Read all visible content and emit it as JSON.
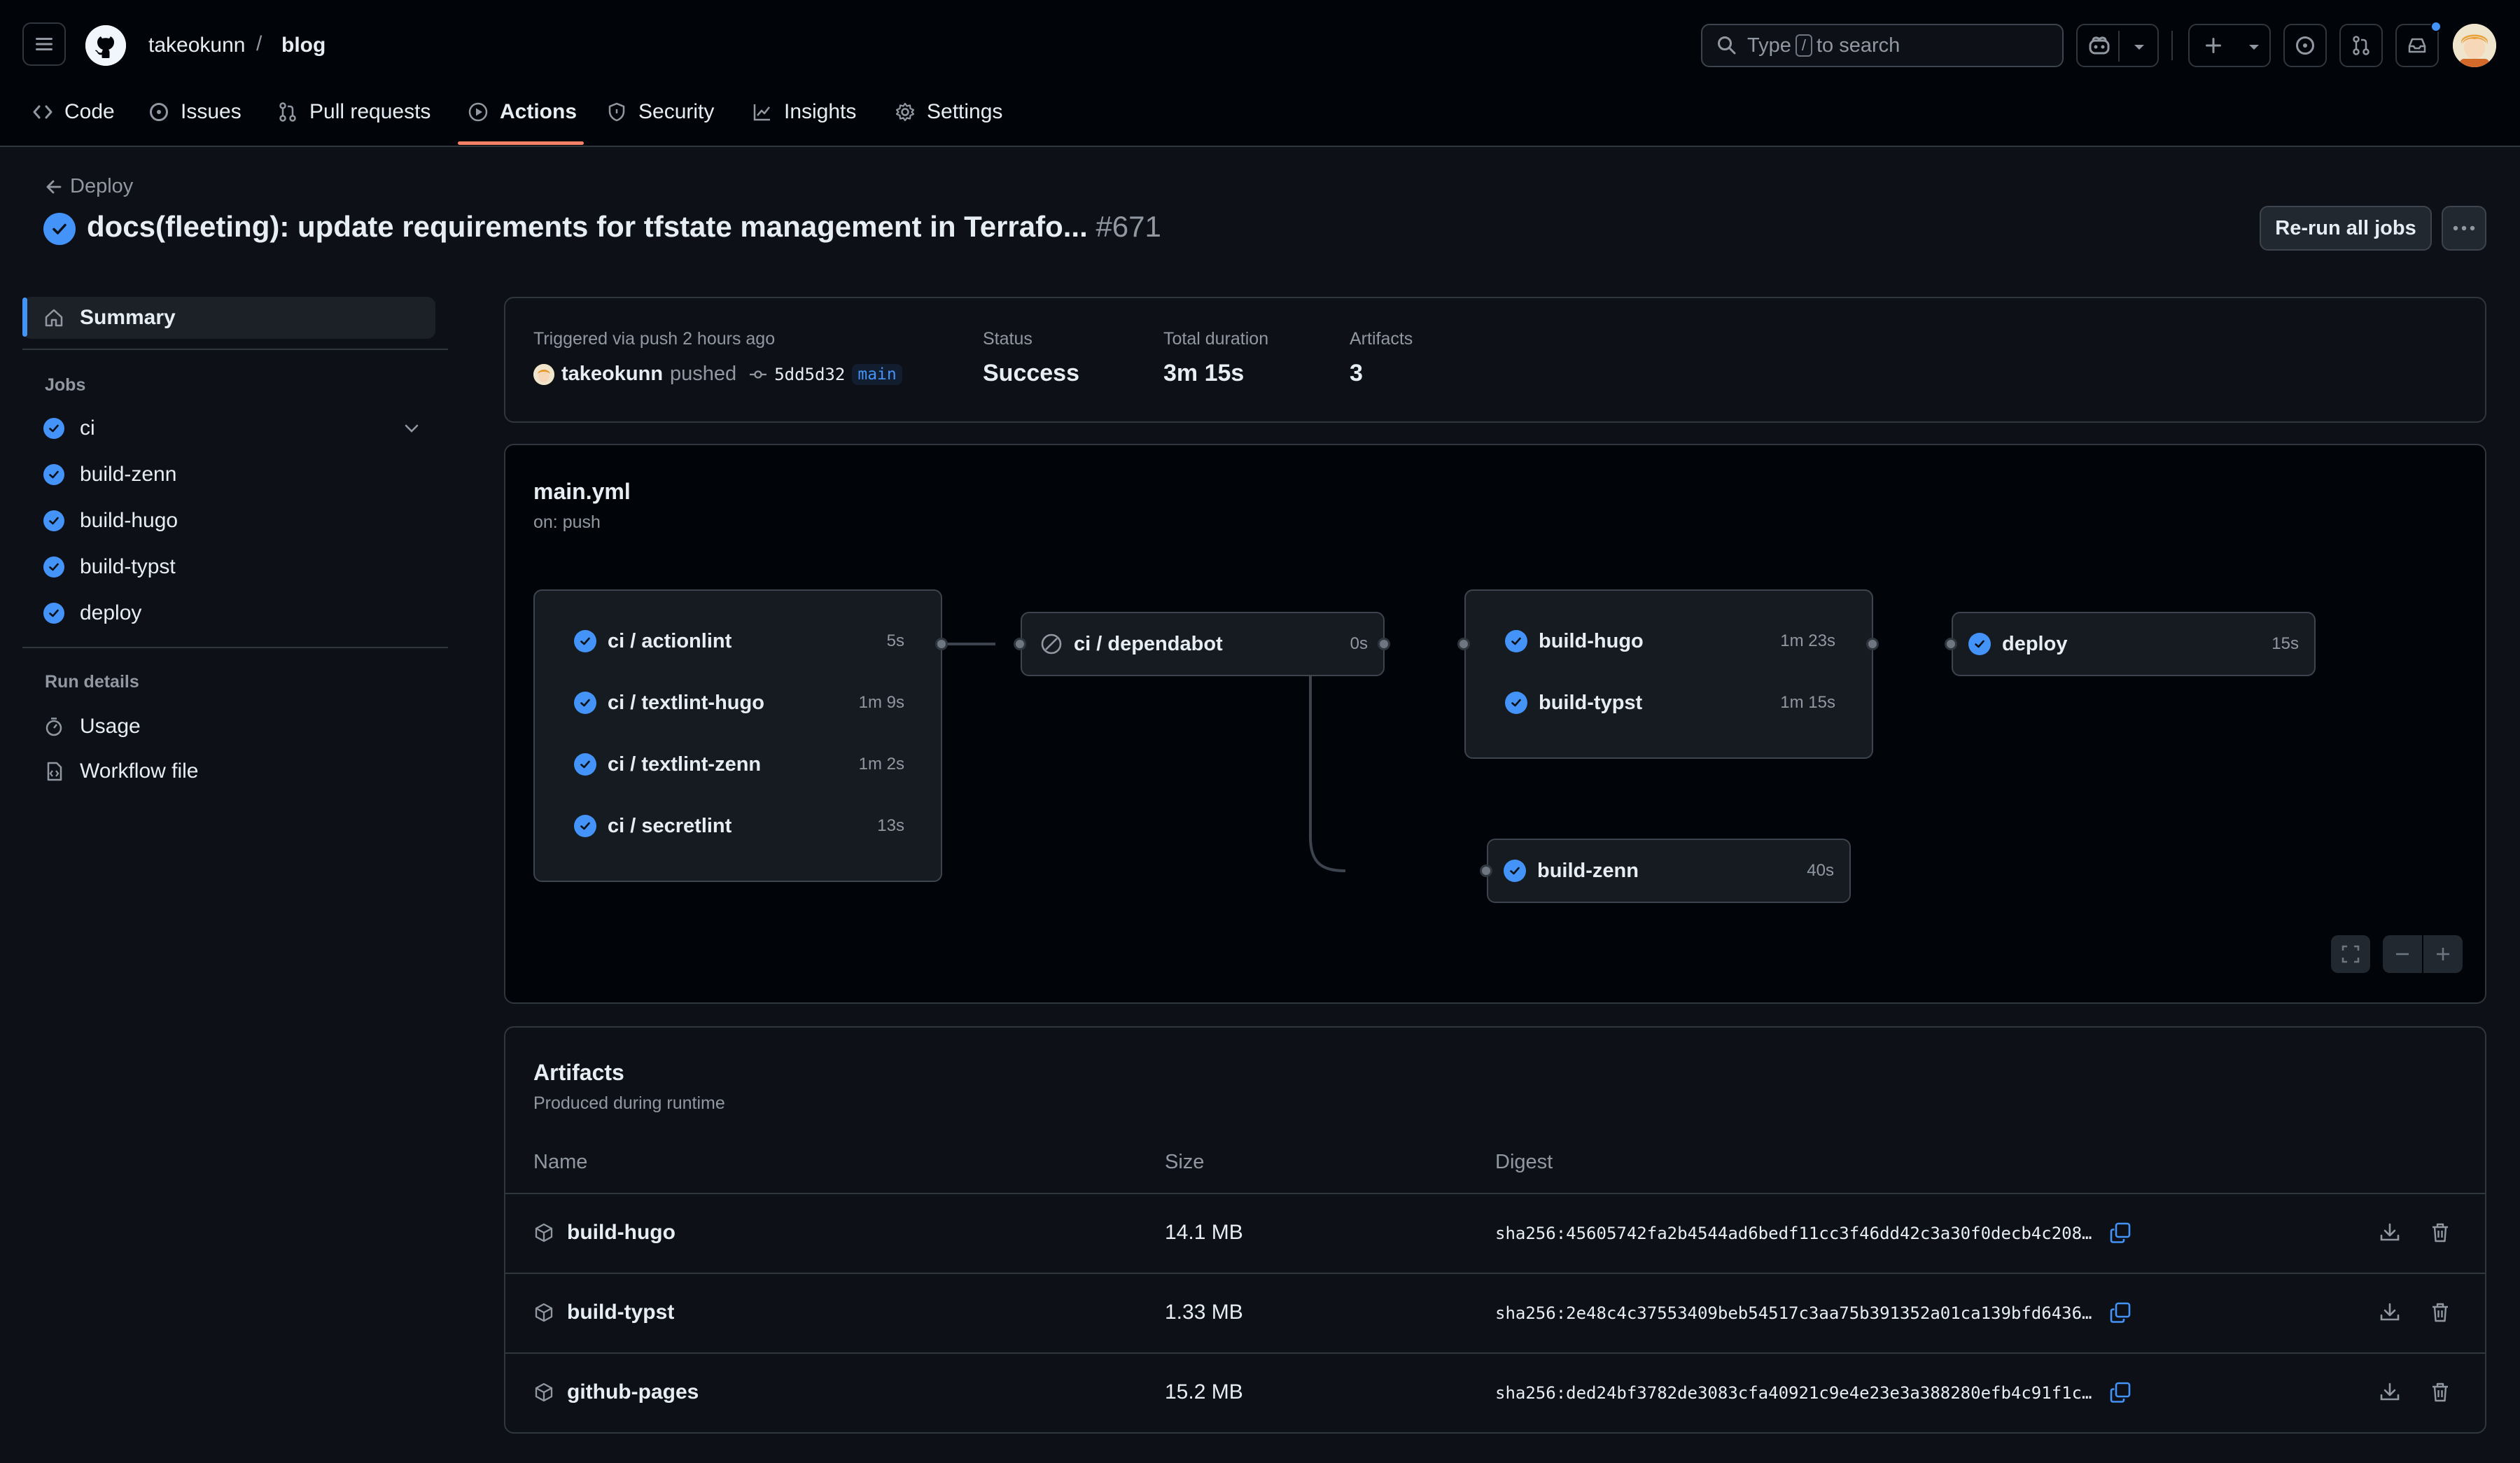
{
  "header": {
    "owner": "takeokunn",
    "separator": "/",
    "repo": "blog",
    "search_prefix": "Type",
    "search_key": "/",
    "search_suffix": "to search"
  },
  "tabs": [
    {
      "label": "Code",
      "icon": "code-icon"
    },
    {
      "label": "Issues",
      "icon": "issue-icon"
    },
    {
      "label": "Pull requests",
      "icon": "pull-request-icon"
    },
    {
      "label": "Actions",
      "icon": "play-icon",
      "active": true
    },
    {
      "label": "Security",
      "icon": "shield-icon"
    },
    {
      "label": "Insights",
      "icon": "graph-icon"
    },
    {
      "label": "Settings",
      "icon": "gear-icon"
    }
  ],
  "run": {
    "back_label": "Deploy",
    "title": "docs(fleeting): update requirements for tfstate management in Terrafo...",
    "number": "#671",
    "rerun_label": "Re-run all jobs"
  },
  "sidebar": {
    "summary": "Summary",
    "jobs_heading": "Jobs",
    "jobs": [
      "ci",
      "build-zenn",
      "build-hugo",
      "build-typst",
      "deploy"
    ],
    "run_details_heading": "Run details",
    "usage": "Usage",
    "workflow_file": "Workflow file"
  },
  "summary": {
    "trigger": "Triggered via push 2 hours ago",
    "actor": "takeokunn",
    "action": "pushed",
    "commit": "5dd5d32",
    "branch": "main",
    "status_label": "Status",
    "status_value": "Success",
    "duration_label": "Total duration",
    "duration_value": "3m 15s",
    "artifacts_label": "Artifacts",
    "artifacts_value": "3"
  },
  "workflow": {
    "file": "main.yml",
    "trigger": "on: push",
    "ci_jobs": [
      {
        "name": "ci / actionlint",
        "duration": "5s"
      },
      {
        "name": "ci / textlint-hugo",
        "duration": "1m 9s"
      },
      {
        "name": "ci / textlint-zenn",
        "duration": "1m 2s"
      },
      {
        "name": "ci / secretlint",
        "duration": "13s"
      }
    ],
    "dependabot": {
      "name": "ci / dependabot",
      "duration": "0s",
      "status": "skipped"
    },
    "build_jobs": [
      {
        "name": "build-hugo",
        "duration": "1m 23s"
      },
      {
        "name": "build-typst",
        "duration": "1m 15s"
      }
    ],
    "build_zenn": {
      "name": "build-zenn",
      "duration": "40s"
    },
    "deploy": {
      "name": "deploy",
      "duration": "15s"
    }
  },
  "artifacts": {
    "title": "Artifacts",
    "subtitle": "Produced during runtime",
    "columns": [
      "Name",
      "Size",
      "Digest"
    ],
    "rows": [
      {
        "name": "build-hugo",
        "size": "14.1 MB",
        "digest": "sha256:45605742fa2b4544ad6bedf11cc3f46dd42c3a30f0decb4c208…"
      },
      {
        "name": "build-typst",
        "size": "1.33 MB",
        "digest": "sha256:2e48c4c37553409beb54517c3aa75b391352a01ca139bfd6436…"
      },
      {
        "name": "github-pages",
        "size": "15.2 MB",
        "digest": "sha256:ded24bf3782de3083cfa40921c9e4e23e3a388280efb4c91f1c…"
      }
    ]
  },
  "colors": {
    "accent": "#4493f8",
    "tab_underline": "#f78166",
    "background": "#0d1117",
    "header_bg": "#010409"
  }
}
